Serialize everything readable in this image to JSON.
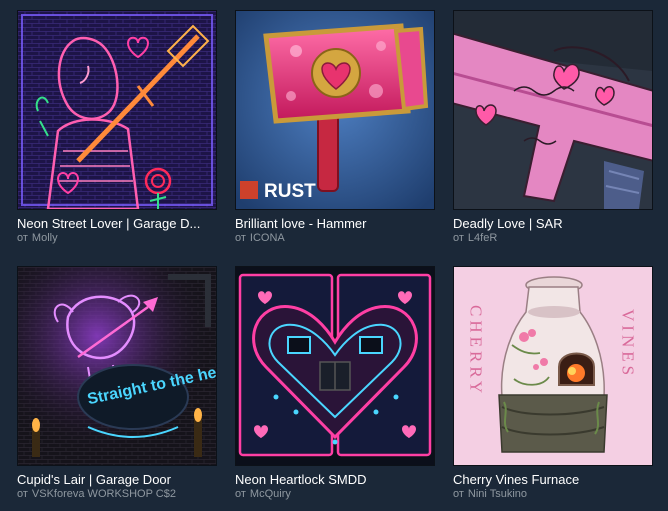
{
  "author_prefix": "от",
  "items": [
    {
      "title": "Neon Street Lover | Garage D...",
      "author": "Molly",
      "thumb": "neon-lover-thumbnail"
    },
    {
      "title": "Brilliant love - Hammer",
      "author": "ICONA",
      "thumb": "hammer-thumbnail",
      "badge": "RUST"
    },
    {
      "title": "Deadly Love | SAR",
      "author": "L4feR",
      "thumb": "sar-rifle-thumbnail"
    },
    {
      "title": "Cupid's Lair | Garage Door",
      "author": "VSKforeva WORKSHOP C$2",
      "thumb": "cupids-lair-thumbnail",
      "neon_text": "Straight to the heart"
    },
    {
      "title": "Neon Heartlock SMDD",
      "author": "McQuiry",
      "thumb": "heartlock-thumbnail"
    },
    {
      "title": "Cherry Vines Furnace",
      "author": "Nini Tsukino",
      "thumb": "furnace-thumbnail",
      "side_left": "CHERRY",
      "side_right": "VINES"
    }
  ],
  "colors": {
    "background": "#1b2838",
    "title": "#ffffff",
    "author": "#8f98a0",
    "neon_pink": "#ff3fa4",
    "neon_cyan": "#4ad6ff"
  }
}
